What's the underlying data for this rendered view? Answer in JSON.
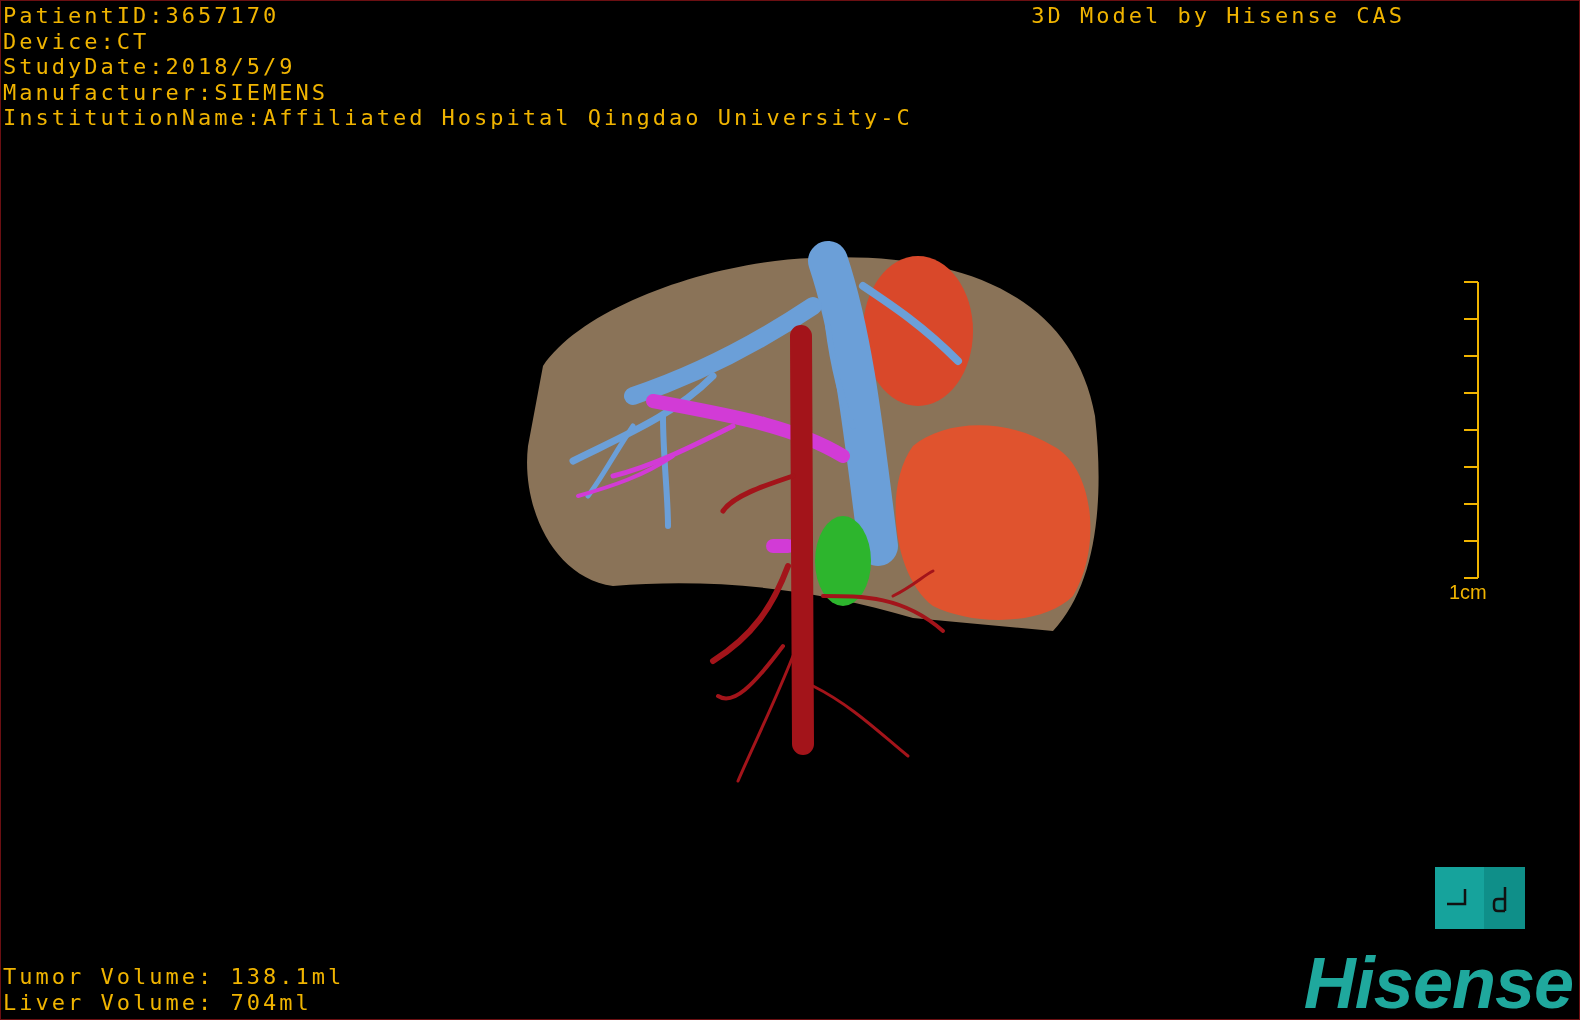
{
  "patient_info": [
    "PatientID:3657170",
    "Device:CT",
    "StudyDate:2018/5/9",
    "Manufacturer:SIEMENS",
    "InstitutionName:Affiliated Hospital Qingdao University-C"
  ],
  "title": "3D Model by Hisense CAS",
  "scale_bar": {
    "label": "1cm"
  },
  "volumes": [
    "Tumor Volume: 138.1ml",
    "Liver Volume: 704ml"
  ],
  "logo": "Hisense"
}
